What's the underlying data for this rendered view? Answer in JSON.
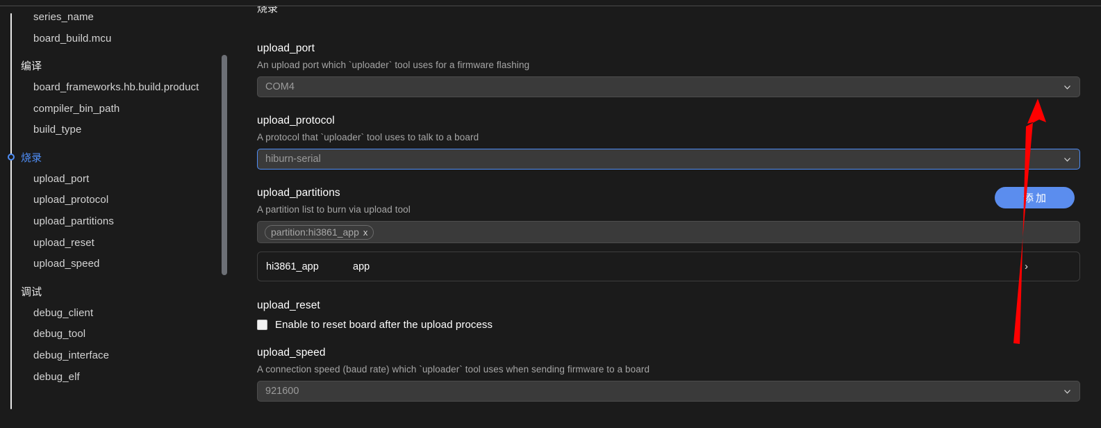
{
  "app": {
    "background": "#1b1b1b",
    "accent": "#4f8ef7",
    "button_color": "#5b8dee",
    "annotation_color": "#ff0000"
  },
  "sidebar": {
    "collapse_icon": "chevron-down-icon",
    "items": [
      {
        "label": "series_name",
        "type": "item",
        "active": false
      },
      {
        "label": "board_build.mcu",
        "type": "item",
        "active": false
      },
      {
        "label": "编译",
        "type": "group",
        "active": false
      },
      {
        "label": "board_frameworks.hb.build.product",
        "type": "item",
        "active": false
      },
      {
        "label": "compiler_bin_path",
        "type": "item",
        "active": false
      },
      {
        "label": "build_type",
        "type": "item",
        "active": false
      },
      {
        "label": "烧录",
        "type": "group",
        "active": true
      },
      {
        "label": "upload_port",
        "type": "item",
        "active": false
      },
      {
        "label": "upload_protocol",
        "type": "item",
        "active": false
      },
      {
        "label": "upload_partitions",
        "type": "item",
        "active": false
      },
      {
        "label": "upload_reset",
        "type": "item",
        "active": false
      },
      {
        "label": "upload_speed",
        "type": "item",
        "active": false
      },
      {
        "label": "调试",
        "type": "group",
        "active": false
      },
      {
        "label": "debug_client",
        "type": "item",
        "active": false
      },
      {
        "label": "debug_tool",
        "type": "item",
        "active": false
      },
      {
        "label": "debug_interface",
        "type": "item",
        "active": false
      },
      {
        "label": "debug_elf",
        "type": "item",
        "active": false
      }
    ]
  },
  "main": {
    "clipped_heading": "烧录",
    "upload_port": {
      "title": "upload_port",
      "description": "An upload port which `uploader` tool uses for a firmware flashing",
      "value": "COM4",
      "dropdown_icon": "chevron-down-icon"
    },
    "upload_protocol": {
      "title": "upload_protocol",
      "description": "A protocol that `uploader` tool uses to talk to a board",
      "value": "hiburn-serial",
      "dropdown_icon": "chevron-down-icon",
      "focused": true
    },
    "upload_partitions": {
      "title": "upload_partitions",
      "description": "A partition list to burn via upload tool",
      "add_button_label": "添加",
      "chips": [
        {
          "label": "partition:hi3861_app",
          "remove_icon": "close-icon",
          "remove_glyph": "x"
        }
      ],
      "rows": [
        {
          "name": "hi3861_app",
          "type": "app",
          "expand_icon": "chevron-right-icon",
          "expand_glyph": "›"
        }
      ]
    },
    "upload_reset": {
      "title": "upload_reset",
      "checkbox_label": "Enable to reset board after the upload process",
      "checked": false
    },
    "upload_speed": {
      "title": "upload_speed",
      "description": "A connection speed (baud rate) which `uploader` tool uses when sending firmware to a board",
      "value": "921600",
      "dropdown_icon": "chevron-down-icon"
    }
  },
  "annotation": {
    "arrow_icon": "red-arrow-up-icon",
    "color": "#ff0000"
  }
}
